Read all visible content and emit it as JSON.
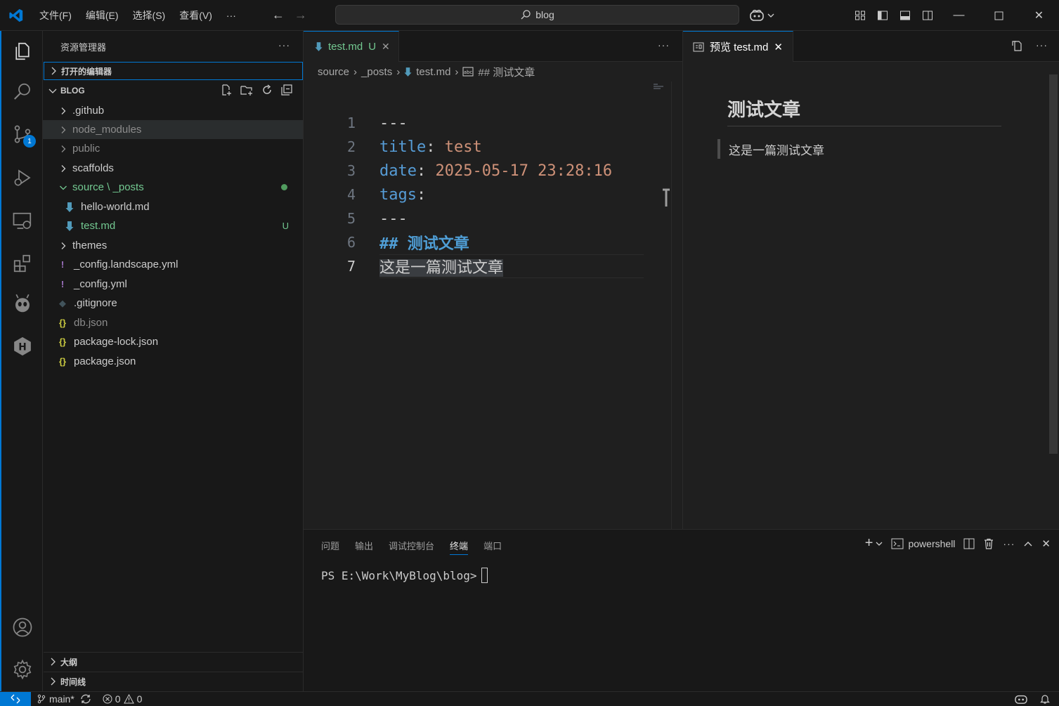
{
  "menu": [
    "文件(F)",
    "编辑(E)",
    "选择(S)",
    "查看(V)",
    "···"
  ],
  "search": {
    "text": "blog"
  },
  "sidebar": {
    "title": "资源管理器",
    "more": "···",
    "open_editors": "打开的编辑器",
    "folder": "BLOG",
    "tree": [
      {
        "label": ".github",
        "type": "folder"
      },
      {
        "label": "node_modules",
        "type": "folder"
      },
      {
        "label": "public",
        "type": "folder"
      },
      {
        "label": "scaffolds",
        "type": "folder"
      },
      {
        "label": "source \\ _posts",
        "type": "folder-open"
      },
      {
        "label": "hello-world.md",
        "type": "md"
      },
      {
        "label": "test.md",
        "type": "md",
        "status": "U"
      },
      {
        "label": "themes",
        "type": "folder"
      },
      {
        "label": "_config.landscape.yml",
        "type": "yml"
      },
      {
        "label": "_config.yml",
        "type": "yml"
      },
      {
        "label": ".gitignore",
        "type": "git"
      },
      {
        "label": "db.json",
        "type": "json"
      },
      {
        "label": "package-lock.json",
        "type": "json"
      },
      {
        "label": "package.json",
        "type": "json"
      }
    ],
    "outline": "大纲",
    "timeline": "时间线"
  },
  "editor": {
    "tab_label": "test.md",
    "tab_status": "U",
    "more": "···",
    "breadcrumb": [
      "source",
      "_posts",
      "test.md",
      "## 测试文章"
    ],
    "lines": [
      {
        "n": "1",
        "parts": [
          [
            "w",
            "---"
          ]
        ]
      },
      {
        "n": "2",
        "parts": [
          [
            "k",
            "title"
          ],
          [
            "w",
            ": "
          ],
          [
            "s",
            "test"
          ]
        ]
      },
      {
        "n": "3",
        "parts": [
          [
            "k",
            "date"
          ],
          [
            "w",
            ": "
          ],
          [
            "s",
            "2025-05-17 23:28:16"
          ]
        ]
      },
      {
        "n": "4",
        "parts": [
          [
            "k",
            "tags"
          ],
          [
            "w",
            ":"
          ]
        ]
      },
      {
        "n": "5",
        "parts": [
          [
            "w",
            "---"
          ]
        ]
      },
      {
        "n": "6",
        "parts": [
          [
            "h",
            "## 测试文章"
          ]
        ]
      },
      {
        "n": "7",
        "parts": [
          [
            "sel",
            "这是一篇测试文章"
          ]
        ]
      }
    ]
  },
  "preview": {
    "tab_label": "预览 test.md",
    "heading": "测试文章",
    "quote": "这是一篇测试文章"
  },
  "panel": {
    "tabs": [
      "问题",
      "输出",
      "调试控制台",
      "终端",
      "端口"
    ],
    "active_tab": "终端",
    "shell": "powershell",
    "prompt": "PS E:\\Work\\MyBlog\\blog>"
  },
  "status": {
    "branch": "main*",
    "errors": "0",
    "warnings": "0"
  }
}
